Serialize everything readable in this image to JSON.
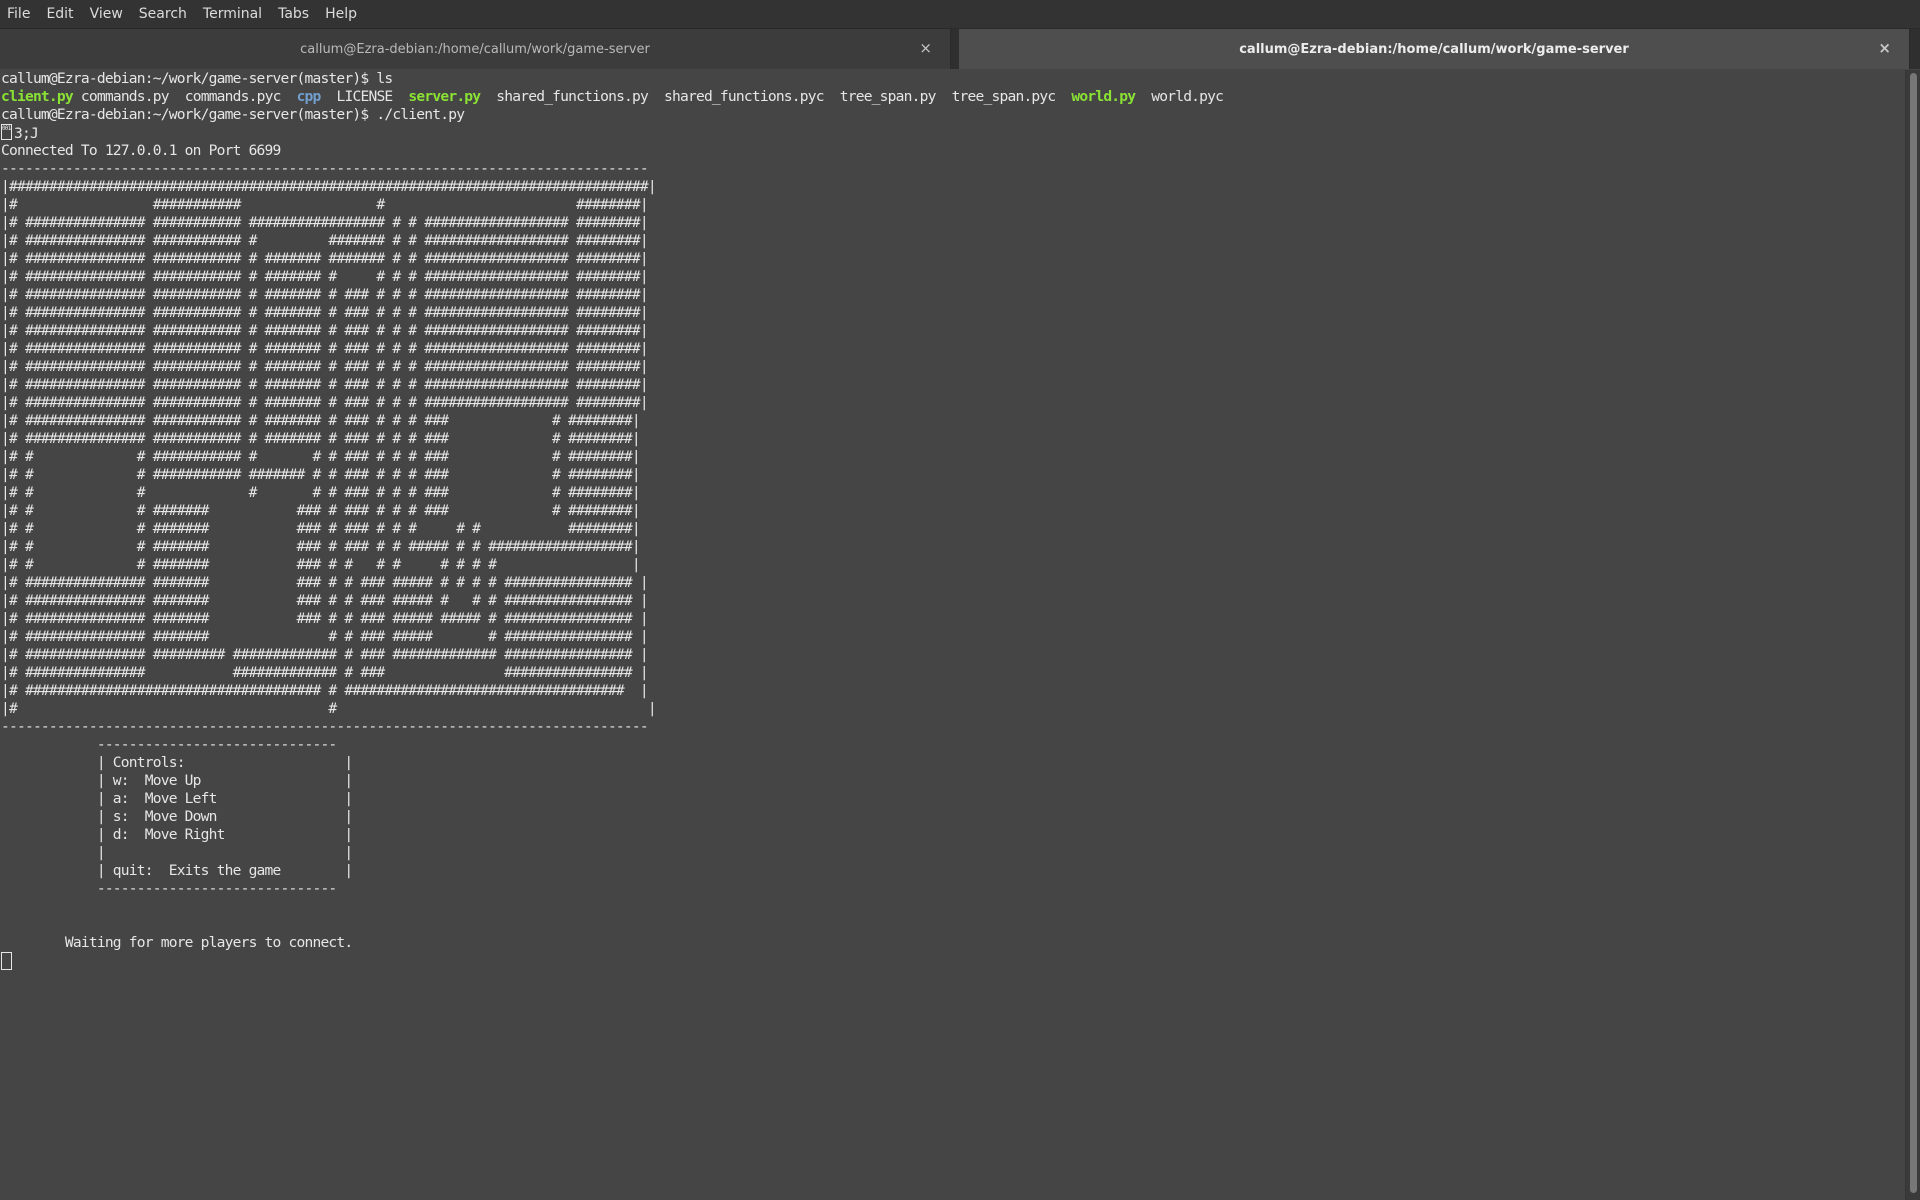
{
  "menubar": {
    "items": [
      "File",
      "Edit",
      "View",
      "Search",
      "Terminal",
      "Tabs",
      "Help"
    ]
  },
  "tabs": [
    {
      "title": "callum@Ezra-debian:/home/callum/work/game-server",
      "active": false,
      "close": "×"
    },
    {
      "title": "callum@Ezra-debian:/home/callum/work/game-server",
      "active": true,
      "close": "×"
    }
  ],
  "terminal": {
    "prompt1": "callum@Ezra-debian:~/work/game-server(master)$ ls",
    "ls_output": [
      {
        "name": "client.py",
        "kind": "exec",
        "sep": " "
      },
      {
        "name": "commands.py",
        "kind": "file",
        "sep": "  "
      },
      {
        "name": "commands.pyc",
        "kind": "file",
        "sep": "  "
      },
      {
        "name": "cpp",
        "kind": "dir",
        "sep": "  "
      },
      {
        "name": "LICENSE",
        "kind": "file",
        "sep": "  "
      },
      {
        "name": "server.py",
        "kind": "exec",
        "sep": "  "
      },
      {
        "name": "shared_functions.py",
        "kind": "file",
        "sep": "  "
      },
      {
        "name": "shared_functions.pyc",
        "kind": "file",
        "sep": "  "
      },
      {
        "name": "tree_span.py",
        "kind": "file",
        "sep": "  "
      },
      {
        "name": "tree_span.pyc",
        "kind": "file",
        "sep": "  "
      },
      {
        "name": "world.py",
        "kind": "exec",
        "sep": "  "
      },
      {
        "name": "world.pyc",
        "kind": "file",
        "sep": ""
      }
    ],
    "prompt2": "callum@Ezra-debian:~/work/game-server(master)$ ./client.py",
    "escape_glyph": "0018",
    "escape_text": "3;J",
    "connected": "Connected To 127.0.0.1 on Port 6699",
    "maze_border": "---------------------------------------------------------------------------------",
    "maze_rows": [
      "|################################################################################|",
      "|#                 ###########                 #                        ########|",
      "|# ############### ########### ################# # # ################## ########|",
      "|# ############### ########### #         ####### # # ################## ########|",
      "|# ############### ########### # ####### ####### # # ################## ########|",
      "|# ############### ########### # ####### #     # # # ################## ########|",
      "|# ############### ########### # ####### # ### # # # ################## ########|",
      "|# ############### ########### # ####### # ### # # # ################## ########|",
      "|# ############### ########### # ####### # ### # # # ################## ########|",
      "|# ############### ########### # ####### # ### # # # ################## ########|",
      "|# ############### ########### # ####### # ### # # # ################## ########|",
      "|# ############### ########### # ####### # ### # # # ################## ########|",
      "|# ############### ########### # ####### # ### # # # ################## ########|",
      "|# ############### ########### # ####### # ### # # # ###             # ########|",
      "|# ############### ########### # ####### # ### # # # ###             # ########|",
      "|# #             # ########### #       # # ### # # # ###             # ########|",
      "|# #             # ########### ####### # # ### # # # ###             # ########|",
      "|# #             #             #       # # ### # # # ###             # ########|",
      "|# #             # #######           ### # ### # # # ###             # ########|",
      "|# #             # #######           ### # ### # # #     # #           ########|",
      "|# #             # #######           ### # ### # # ##### # # ##################|",
      "|# #             # #######           ### # #   # #     # # # #                 |",
      "|# ############### #######           ### # # ### ##### # # # # ################ |",
      "|# ############### #######           ### # # ### ##### #   # # ################ |",
      "|# ############### #######           ### # # ### ##### ##### # ################ |",
      "|# ############### #######               # # ### #####       # ################ |",
      "|# ############### ######### ############# # ### ############# ################ |",
      "|# ###############           ############# # ###               ################ |",
      "|# ##################################### # ###################################  |",
      "|#                                       #                                       |"
    ],
    "controls_border": "------------------------------",
    "controls_lines": [
      "| Controls:                    |",
      "| w:  Move Up                  |",
      "| a:  Move Left                |",
      "| s:  Move Down                |",
      "| d:  Move Right               |",
      "|                              |",
      "| quit:  Exits the game        |"
    ],
    "controls_indent": "            ",
    "waiting": "        Waiting for more players to connect."
  }
}
